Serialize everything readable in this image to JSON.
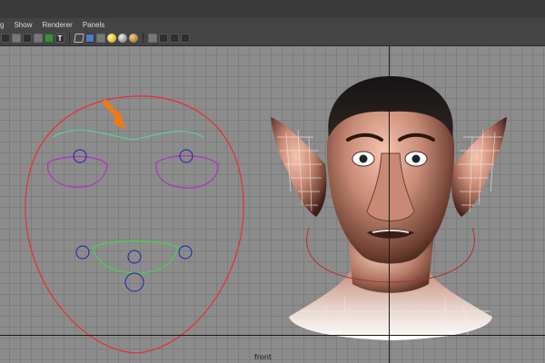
{
  "menu": {
    "items": [
      "g",
      "Show",
      "Renderer",
      "Panels"
    ]
  },
  "toolbar": {
    "t_label": "T"
  },
  "viewport": {
    "camera_label": "front"
  },
  "colors": {
    "face_outline": "#e0343a",
    "brow_curve": "#58d29a",
    "eye_loops": "#b12fc1",
    "mouth_loop": "#4ad24a",
    "control_circles": "#2020a6",
    "arrow": "#f07a18"
  }
}
